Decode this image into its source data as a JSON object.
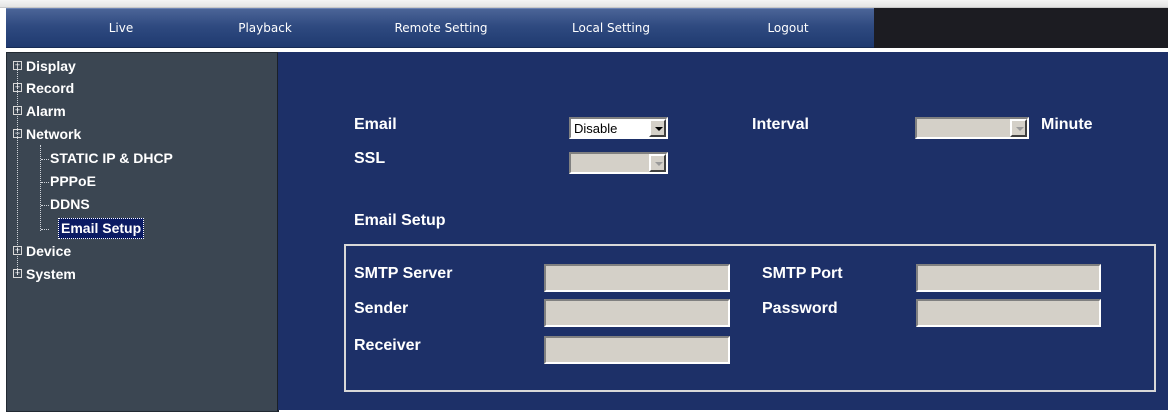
{
  "nav": {
    "items": [
      "Live",
      "Playback",
      "Remote Setting",
      "Local Setting",
      "Logout"
    ]
  },
  "sidebar": {
    "items": [
      {
        "label": "Display",
        "expanded": false
      },
      {
        "label": "Record",
        "expanded": false
      },
      {
        "label": "Alarm",
        "expanded": false
      },
      {
        "label": "Network",
        "expanded": true
      },
      {
        "label": "STATIC IP & DHCP",
        "child": true
      },
      {
        "label": "PPPoE",
        "child": true
      },
      {
        "label": "DDNS",
        "child": true
      },
      {
        "label": "Email Setup",
        "child": true,
        "selected": true
      },
      {
        "label": "Device",
        "expanded": false
      },
      {
        "label": "System",
        "expanded": false
      }
    ],
    "expand_glyph": "+",
    "collapse_glyph": "−"
  },
  "email": {
    "email_label": "Email",
    "email_value": "Disable",
    "interval_label": "Interval",
    "interval_value": "",
    "minute_label": "Minute",
    "ssl_label": "SSL",
    "ssl_value": ""
  },
  "setup": {
    "title": "Email Setup",
    "smtp_server_label": "SMTP Server",
    "smtp_server_value": "",
    "smtp_port_label": "SMTP Port",
    "smtp_port_value": "",
    "sender_label": "Sender",
    "sender_value": "",
    "password_label": "Password",
    "password_value": "",
    "receiver_label": "Receiver",
    "receiver_value": ""
  },
  "colors": {
    "nav": "#2f4a80",
    "sidebar": "#3b4652",
    "main": "#1d3068",
    "selected": "#0b1b63"
  }
}
